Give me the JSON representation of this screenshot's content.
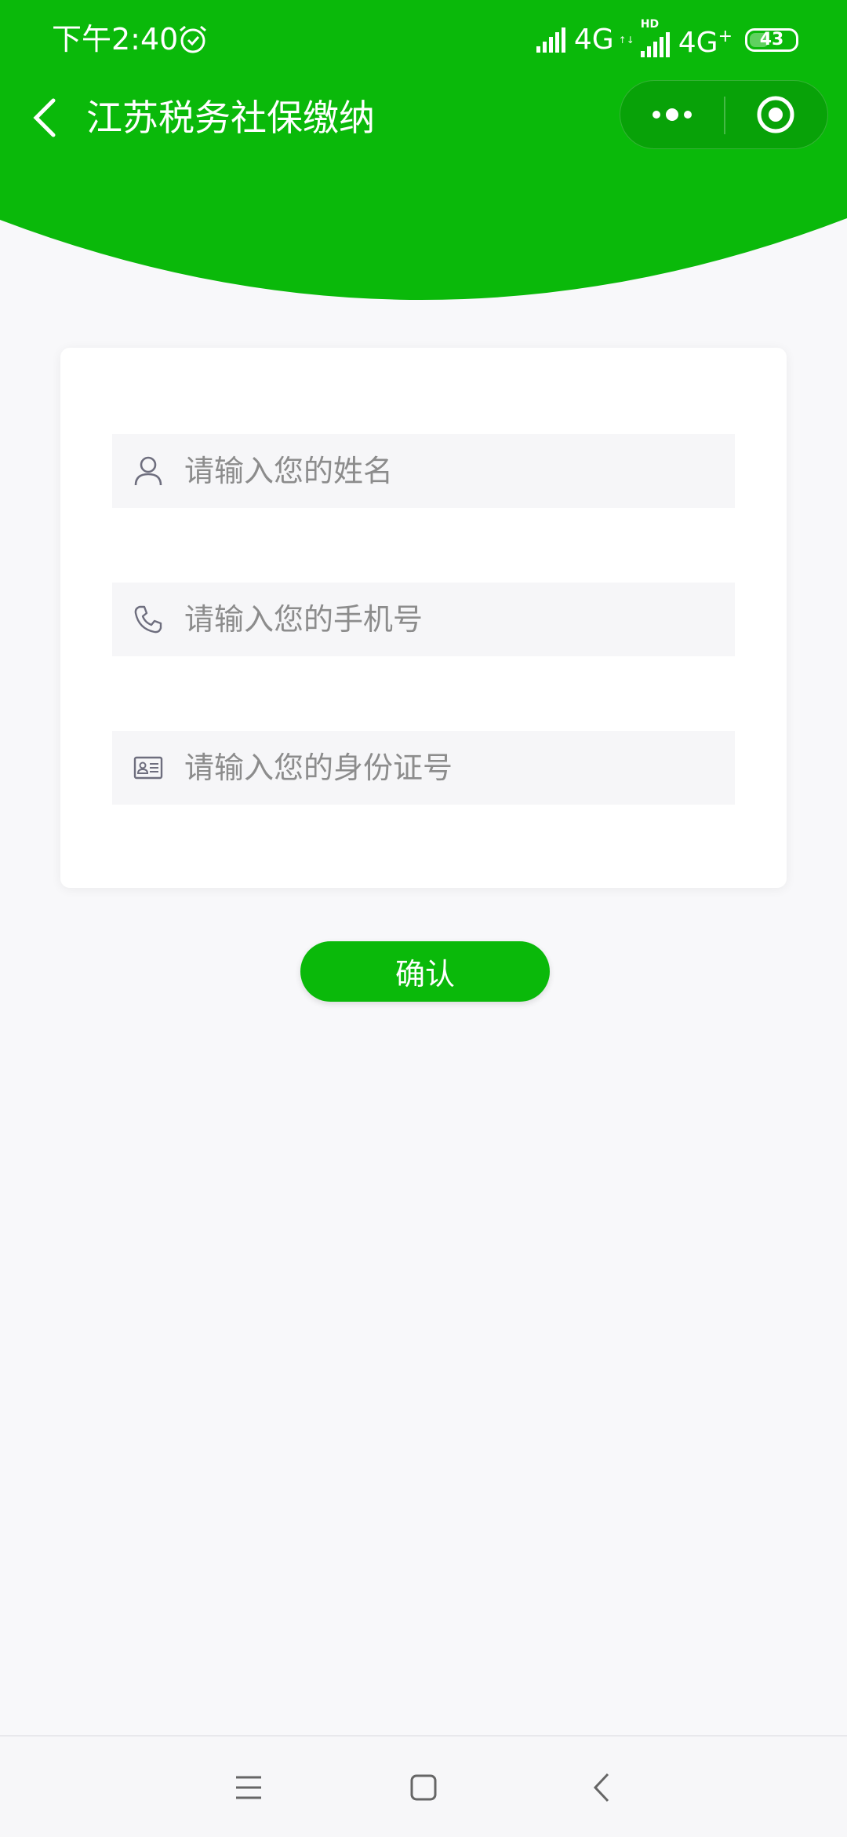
{
  "status_bar": {
    "time": "下午2:40",
    "network1": "4G",
    "network1_sub": "↑↓",
    "network2_badge": "HD",
    "network2": "4G",
    "network2_plus": "+",
    "battery": "43"
  },
  "nav": {
    "title": "江苏税务社保缴纳",
    "icons": [
      "back-arrow-icon",
      "more-dots-icon",
      "close-target-icon"
    ]
  },
  "form": {
    "name_placeholder": "请输入您的姓名",
    "phone_placeholder": "请输入您的手机号",
    "id_placeholder": "请输入您的身份证号",
    "field_icons": [
      "user-icon",
      "phone-icon",
      "id-card-icon"
    ]
  },
  "confirm_label": "确认",
  "system_nav": {
    "icons": [
      "menu-icon",
      "home-icon",
      "back-icon"
    ]
  },
  "colors": {
    "brand_green": "#0ab90a",
    "background": "#f8f8fa",
    "field_bg": "#f6f6f8",
    "placeholder": "#8c8c8c"
  }
}
